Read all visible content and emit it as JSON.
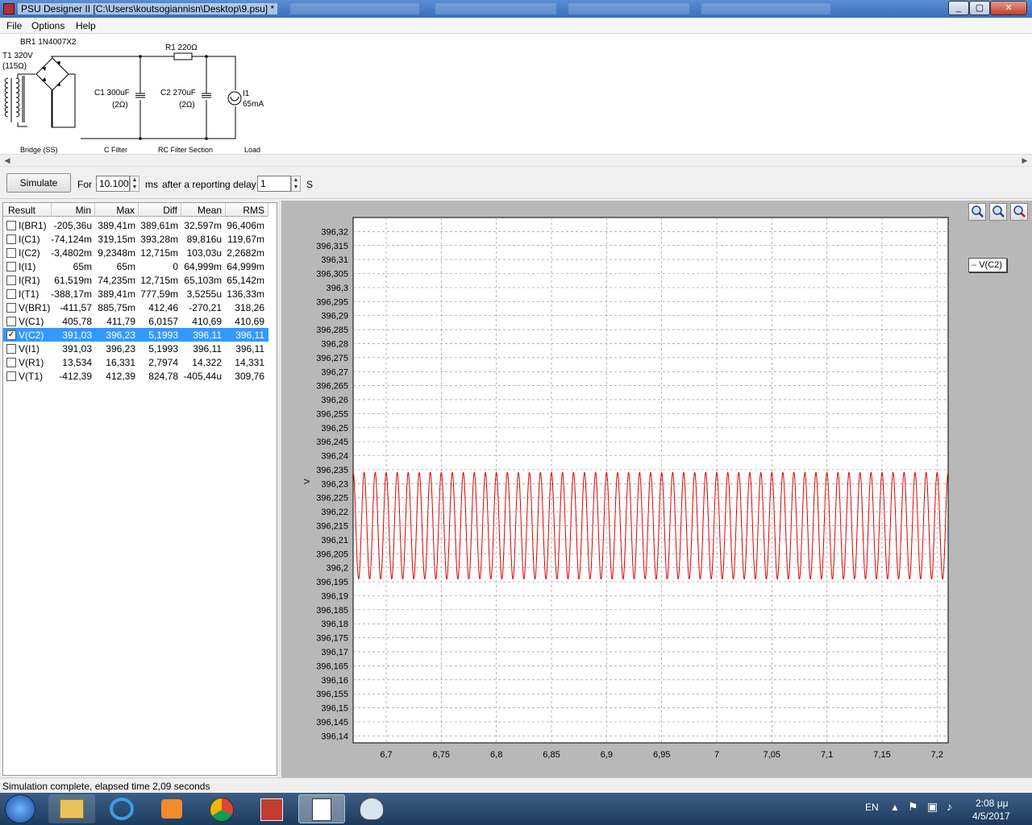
{
  "window": {
    "title": "PSU Designer II  [C:\\Users\\koutsogiannisn\\Desktop\\9.psu] *",
    "min": "_",
    "max": "▢",
    "close": "✕"
  },
  "menu": [
    "File",
    "Options",
    "Help"
  ],
  "schematic": {
    "br1": "BR1 1N4007X2",
    "t1": "T1 320V",
    "t1_res": "(115Ω)",
    "r1": "R1 220Ω",
    "c1": "C1 300uF",
    "c1_res": "(2Ω)",
    "c2": "C2 270uF",
    "c2_res": "(2Ω)",
    "i1": "I1",
    "i1_val": "65mA",
    "sections": [
      "Bridge (SS)",
      "C Filter",
      "RC Filter Section",
      "Load"
    ]
  },
  "controls": {
    "simulate": "Simulate",
    "for_label": "For",
    "duration": "10.100",
    "ms_label": "ms",
    "delay_label": "after a reporting delay of",
    "delay": "1",
    "s_label": "S"
  },
  "results": {
    "headers": [
      "Result",
      "Min",
      "Max",
      "Diff",
      "Mean",
      "RMS"
    ],
    "rows": [
      {
        "name": "I(BR1)",
        "min": "-205,36u",
        "max": "389,41m",
        "diff": "389,61m",
        "mean": "32,597m",
        "rms": "96,406m",
        "checked": false
      },
      {
        "name": "I(C1)",
        "min": "-74,124m",
        "max": "319,15m",
        "diff": "393,28m",
        "mean": "89,816u",
        "rms": "119,67m",
        "checked": false
      },
      {
        "name": "I(C2)",
        "min": "-3,4802m",
        "max": "9,2348m",
        "diff": "12,715m",
        "mean": "103,03u",
        "rms": "2,2682m",
        "checked": false
      },
      {
        "name": "I(I1)",
        "min": "65m",
        "max": "65m",
        "diff": "0",
        "mean": "64,999m",
        "rms": "64,999m",
        "checked": false
      },
      {
        "name": "I(R1)",
        "min": "61,519m",
        "max": "74,235m",
        "diff": "12,715m",
        "mean": "65,103m",
        "rms": "65,142m",
        "checked": false
      },
      {
        "name": "I(T1)",
        "min": "-388,17m",
        "max": "389,41m",
        "diff": "777,59m",
        "mean": "3,5255u",
        "rms": "136,33m",
        "checked": false
      },
      {
        "name": "V(BR1)",
        "min": "-411,57",
        "max": "885,75m",
        "diff": "412,46",
        "mean": "-270,21",
        "rms": "318,26",
        "checked": false
      },
      {
        "name": "V(C1)",
        "min": "405,78",
        "max": "411,79",
        "diff": "6,0157",
        "mean": "410,69",
        "rms": "410,69",
        "checked": false
      },
      {
        "name": "V(C2)",
        "min": "391,03",
        "max": "396,23",
        "diff": "5,1993",
        "mean": "396,11",
        "rms": "396,11",
        "checked": true
      },
      {
        "name": "V(I1)",
        "min": "391,03",
        "max": "396,23",
        "diff": "5,1993",
        "mean": "396,11",
        "rms": "396,11",
        "checked": false
      },
      {
        "name": "V(R1)",
        "min": "13,534",
        "max": "16,331",
        "diff": "2,7974",
        "mean": "14,322",
        "rms": "14,331",
        "checked": false
      },
      {
        "name": "V(T1)",
        "min": "-412,39",
        "max": "412,39",
        "diff": "824,78",
        "mean": "-405,44u",
        "rms": "309,76",
        "checked": false
      }
    ]
  },
  "legend": "V(C2)",
  "chart_data": {
    "type": "line",
    "ylabel": "V",
    "xlabel": "",
    "title": "",
    "xlim": [
      6.67,
      7.21
    ],
    "ylim": [
      396.1375,
      396.325
    ],
    "y_ticks": [
      "396,32",
      "396,315",
      "396,31",
      "396,305",
      "396,3",
      "396,295",
      "396,29",
      "396,285",
      "396,28",
      "396,275",
      "396,27",
      "396,265",
      "396,26",
      "396,255",
      "396,25",
      "396,245",
      "396,24",
      "396,235",
      "396,23",
      "396,225",
      "396,22",
      "396,215",
      "396,21",
      "396,205",
      "396,2",
      "396,195",
      "396,19",
      "396,185",
      "396,18",
      "396,175",
      "396,17",
      "396,165",
      "396,16",
      "396,155",
      "396,15",
      "396,145",
      "396,14"
    ],
    "x_ticks": [
      "6,7",
      "6,75",
      "6,8",
      "6,85",
      "6,9",
      "6,95",
      "7",
      "7,05",
      "7,1",
      "7,15",
      "7,2"
    ],
    "series": [
      {
        "name": "V(C2)",
        "color": "#e00000",
        "waveform": "periodic ripple",
        "period": 0.01,
        "min": 396.196,
        "max": 396.234,
        "x_start": 6.67,
        "x_end": 7.21
      }
    ],
    "grid": true,
    "legend_position": "top-right"
  },
  "status": "Simulation complete, elapsed time 2,09 seconds",
  "tray": {
    "lang": "EN",
    "time": "2:08 μμ",
    "date": "4/5/2017"
  }
}
